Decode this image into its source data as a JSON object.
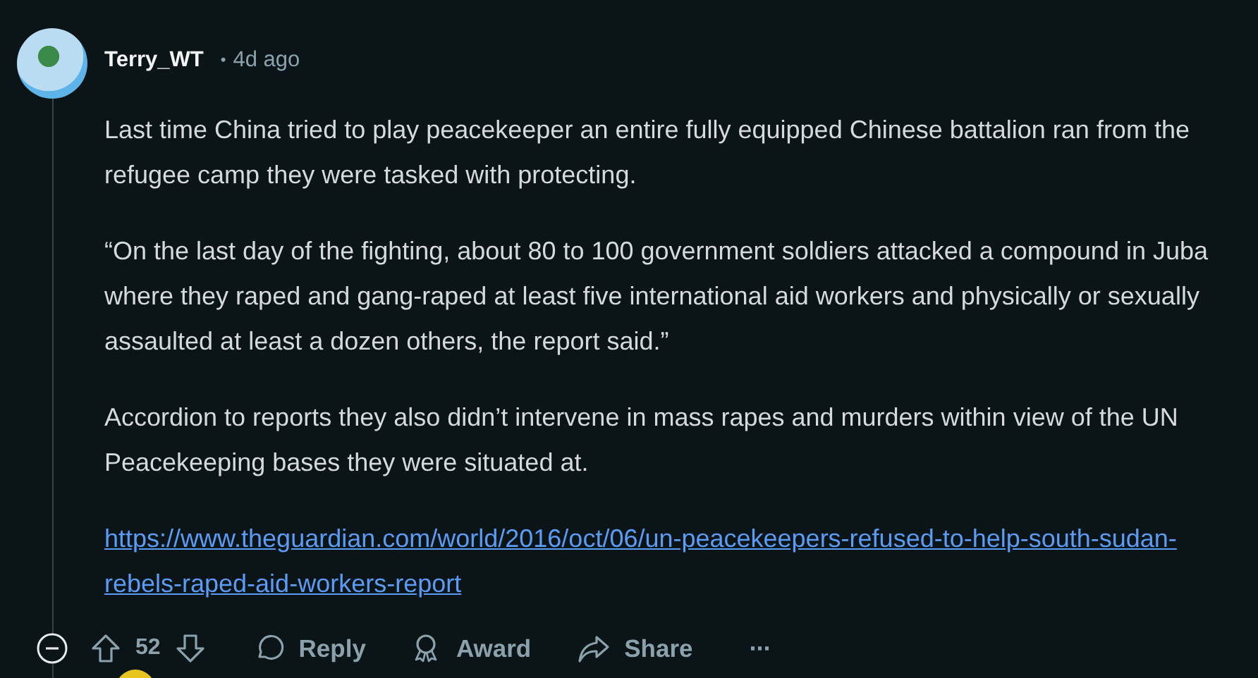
{
  "comment": {
    "author": "Terry_WT",
    "separator": "•",
    "time": "4d ago",
    "paragraphs": [
      "Last time China tried to play peacekeeper an entire fully equipped Chinese battalion ran from the refugee camp they were tasked with protecting.",
      "“On the last day of the fighting, about 80 to 100 government soldiers attacked a compound in Juba where they raped and gang-raped at least five international aid workers and physically or sexually assaulted at least a dozen others, the report said.”",
      "Accordion to reports they also didn’t intervene in mass rapes and murders within view of the UN Peacekeeping bases they were situated at."
    ],
    "link": "https://www.theguardian.com/world/2016/oct/06/un-peacekeepers-refused-to-help-south-sudan-rebels-raped-aid-workers-report",
    "score": "52",
    "actions": [
      {
        "kind": "reply",
        "label": "Reply"
      },
      {
        "kind": "award",
        "label": "Award"
      },
      {
        "kind": "share",
        "label": "Share"
      }
    ],
    "more": "···"
  }
}
